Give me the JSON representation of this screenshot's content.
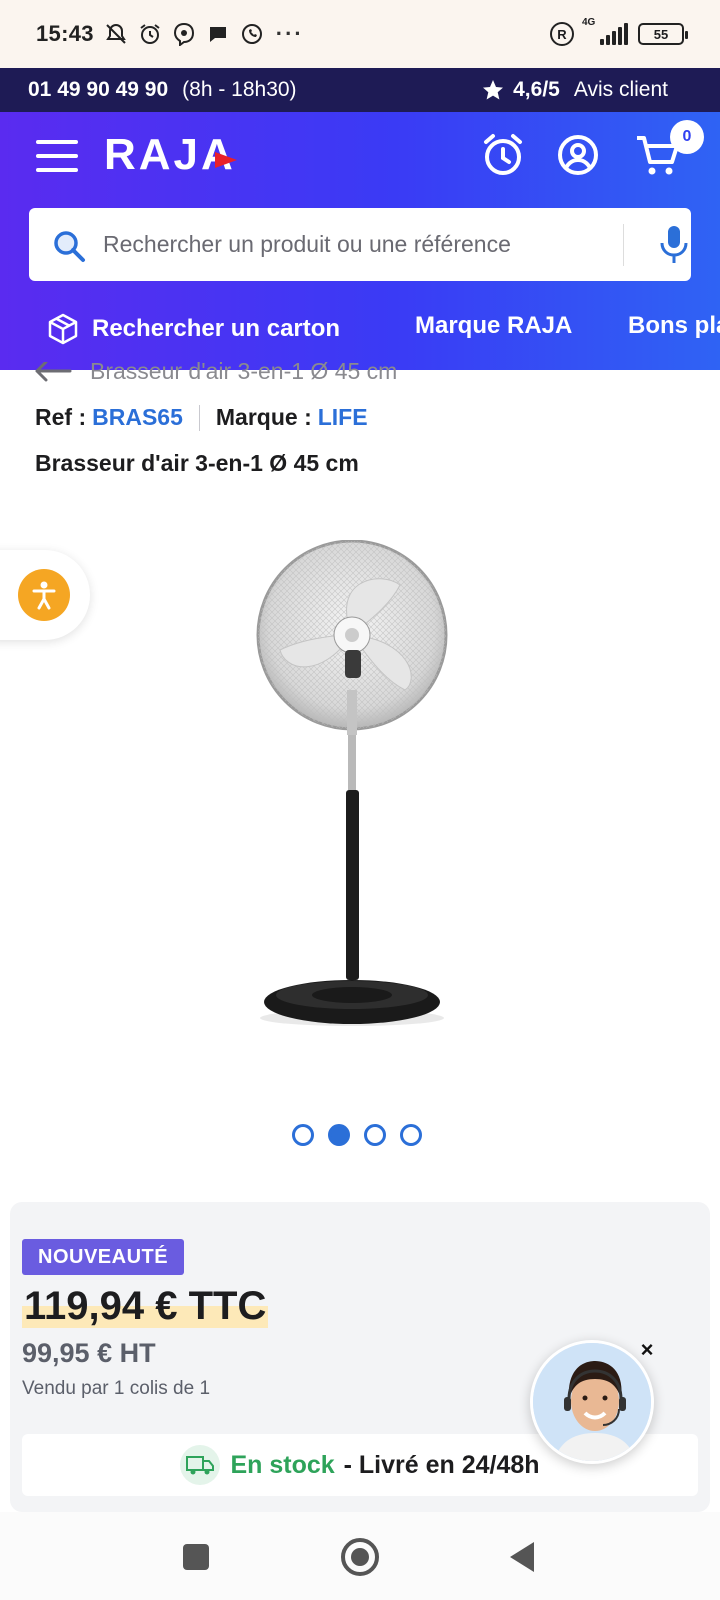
{
  "status_bar": {
    "time": "15:43",
    "network": "4G",
    "battery": "55"
  },
  "top_bar": {
    "phone": "01 49 90 49 90",
    "hours": "(8h - 18h30)",
    "rating": "4,6/5",
    "rating_label": "Avis client"
  },
  "header": {
    "logo": "RAJA",
    "cart_count": "0",
    "search_placeholder": "Rechercher un produit ou une référence",
    "nav": [
      {
        "label": "Rechercher un carton"
      },
      {
        "label": "Marque RAJA"
      },
      {
        "label": "Bons plans"
      }
    ]
  },
  "product": {
    "breadcrumb": "Brasseur d'air 3-en-1 Ø 45 cm",
    "ref_label": "Ref :",
    "ref_value": "BRAS65",
    "brand_label": "Marque :",
    "brand_value": "LIFE",
    "title": "Brasseur d'air 3-en-1 Ø 45 cm",
    "image_count": 4,
    "active_image": 2,
    "badge": "NOUVEAUTÉ",
    "price_ttc": "119,94 € TTC",
    "price_ht": "99,95 € HT",
    "sold_by": "Vendu par 1 colis de 1",
    "stock_status": "En stock",
    "delivery": " - Livré en 24/48h"
  },
  "chat": {
    "close": "×"
  },
  "colors": {
    "header_gradient_start": "#5a2bf0",
    "header_gradient_end": "#2f63f4",
    "top_bar": "#1e1b55",
    "link_blue": "#2b6fd8",
    "badge_purple": "#6a5ce0",
    "stock_green": "#2ea35a",
    "a11y_orange": "#f5a623"
  },
  "icons": [
    "mute-bell-icon",
    "alarm-icon",
    "viber-icon",
    "chat-bubble-icon",
    "whatsapp-icon",
    "menu-icon",
    "alarm-clock-icon",
    "user-account-icon",
    "cart-icon",
    "search-icon",
    "microphone-icon",
    "box-icon",
    "back-arrow-icon",
    "accessibility-icon",
    "truck-icon"
  ]
}
